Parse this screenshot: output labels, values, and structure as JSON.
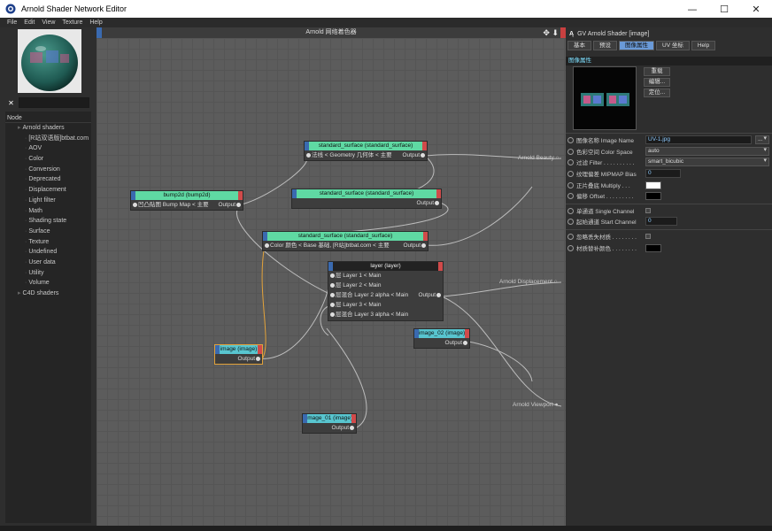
{
  "window": {
    "title": "Arnold Shader Network Editor",
    "minimize": "—",
    "maximize": "☐",
    "close": "✕"
  },
  "menu": [
    "File",
    "Edit",
    "View",
    "Texture",
    "Help"
  ],
  "tree": {
    "header": "Node",
    "items": [
      {
        "label": "Arnold shaders",
        "level": 1
      },
      {
        "label": "[R站双语版]btbat.com",
        "level": 2
      },
      {
        "label": "AOV",
        "level": 2
      },
      {
        "label": "Color",
        "level": 2
      },
      {
        "label": "Conversion",
        "level": 2
      },
      {
        "label": "Deprecated",
        "level": 2
      },
      {
        "label": "Displacement",
        "level": 2
      },
      {
        "label": "Light filter",
        "level": 2
      },
      {
        "label": "Math",
        "level": 2
      },
      {
        "label": "Shading state",
        "level": 2
      },
      {
        "label": "Surface",
        "level": 2
      },
      {
        "label": "Texture",
        "level": 2
      },
      {
        "label": "Undefined",
        "level": 2
      },
      {
        "label": "User data",
        "level": 2
      },
      {
        "label": "Utility",
        "level": 2
      },
      {
        "label": "Volume",
        "level": 2
      },
      {
        "label": "C4D shaders",
        "level": 1
      }
    ]
  },
  "canvas": {
    "title": "Arnold 网络着色器",
    "tools": "✥ ⬇",
    "outputs": {
      "beauty": "Arnold Beauty",
      "displacement": "Arnold Displacement",
      "viewport": "Arnold Viewport"
    },
    "nodes": {
      "ss1": {
        "title": "standard_surface (standard_surface)",
        "in": "法线 < Geometry 几何体 < 主要",
        "out": "Output"
      },
      "bump": {
        "title": "bump2d (bump2d)",
        "in": "凹凸贴图 Bump Map < 主要",
        "out": "Output"
      },
      "ss2": {
        "title": "standard_surface (standard_surface)",
        "out": "Output"
      },
      "ss3": {
        "title": "standard_surface (standard_surface)",
        "in": "Color 颜色 < Base 基础, [R站]btbat.com < 主要",
        "out": "Output"
      },
      "layer": {
        "title": "layer (layer)",
        "ports": [
          "层 Layer 1 < Main",
          "层 Layer 2 < Main",
          "层混合 Layer 2 alpha < Main",
          "层 Layer 3 < Main",
          "层混合 Layer 3 alpha < Main"
        ],
        "out": "Output"
      },
      "image02": {
        "title": "image_02 (image)",
        "out": "Output"
      },
      "image_a": {
        "title": "image (image)",
        "out": "Output"
      },
      "image01": {
        "title": "image_01 (image)",
        "out": "Output"
      }
    }
  },
  "right": {
    "header": "GV Arnold Shader [image]",
    "tabs": [
      "基本",
      "预设",
      "图像属性",
      "UV 坐标",
      "Help"
    ],
    "active_tab": 2,
    "section": "图像属性",
    "buttons": [
      "重载",
      "编辑...",
      "定位..."
    ],
    "props": {
      "image_name": {
        "label": "图像名称 Image Name",
        "value": "UV-1.jpg",
        "btn": "..."
      },
      "color_space": {
        "label": "色彩空间 Color Space",
        "value": "auto"
      },
      "filter": {
        "label": "过滤 Filter . . . . . . . . . .",
        "value": "smart_bicubic"
      },
      "mip": {
        "label": "纹理偏差 MIPMAP Bias",
        "value": "0"
      },
      "multiply": {
        "label": "正片叠底 Multiply . . .",
        "color": "#ffffff"
      },
      "offset": {
        "label": "偏移 Offset . . . . . . . . .",
        "color": "#000000"
      },
      "single_channel": {
        "label": "单通道 Single Channel"
      },
      "start_channel": {
        "label": "起始通道 Start Channel",
        "value": "0"
      },
      "ignore_missing": {
        "label": "忽略丢失材质 . . . . . . . ."
      },
      "missing_color": {
        "label": "材质替补颜色 . . . . . . . .",
        "color": "#000000"
      }
    }
  }
}
